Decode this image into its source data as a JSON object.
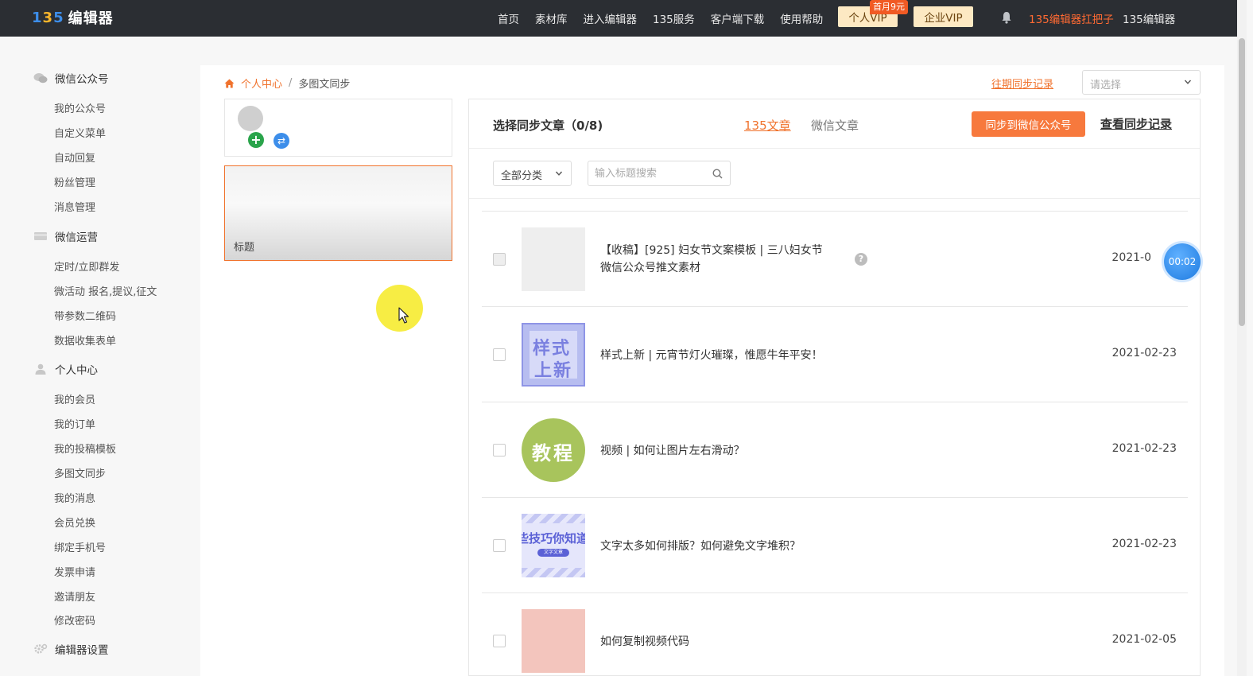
{
  "header": {
    "logo_mark": "135",
    "logo_text": "编辑器",
    "nav": [
      "首页",
      "素材库",
      "进入编辑器",
      "135服务",
      "客户端下载",
      "使用帮助"
    ],
    "vip_personal": "个人VIP",
    "vip_badge": "首月9元",
    "vip_enterprise": "企业VIP",
    "user_link": "135编辑器扛把子",
    "user_name": "135编辑器"
  },
  "sidebar": {
    "groups": [
      {
        "label": "微信公众号",
        "icon": "wechat-icon",
        "items": [
          "我的公众号",
          "自定义菜单",
          "自动回复",
          "粉丝管理",
          "消息管理"
        ]
      },
      {
        "label": "微信运营",
        "icon": "card-icon",
        "items": [
          "定时/立即群发",
          "微活动 报名,提议,征文",
          "带参数二维码",
          "数据收集表单"
        ]
      },
      {
        "label": "个人中心",
        "icon": "user-icon",
        "items": [
          "我的会员",
          "我的订单",
          "我的投稿模板",
          "多图文同步",
          "我的消息",
          "会员兑换",
          "绑定手机号",
          "发票申请",
          "邀请朋友",
          "修改密码"
        ]
      },
      {
        "label": "编辑器设置",
        "icon": "gear-icon",
        "items": []
      }
    ]
  },
  "breadcrumb": {
    "parent": "个人中心",
    "separator": "/",
    "current": "多图文同步"
  },
  "history_link": "往期同步记录",
  "account_select": {
    "placeholder": "请选择"
  },
  "cover": {
    "title": "标题"
  },
  "panel": {
    "title": "选择同步文章（0/8)",
    "tab_135": "135文章",
    "tab_wechat": "微信文章",
    "sync_button": "同步到微信公众号",
    "view_record": "查看同步记录",
    "category": "全部分类",
    "search_placeholder": "输入标题搜索"
  },
  "timer": "00:02",
  "articles": [
    {
      "title_line1": "【收稿】[925] 妇女节文案模板 | 三八妇女节",
      "title_line2": "微信公众号推文素材",
      "date": "2021-0",
      "thumb": "blank"
    },
    {
      "title_line1": "样式上新 | 元宵节灯火璀璨，惟愿牛年平安！",
      "date": "2021-02-23",
      "thumb": "style",
      "thumb_text_1": "样式",
      "thumb_text_2": "上新"
    },
    {
      "title_line1": "视频 | 如何让图片左右滑动？",
      "date": "2021-02-23",
      "thumb": "tutorial",
      "thumb_text": "教程"
    },
    {
      "title_line1": "文字太多如何排版？如何避免文字堆积？",
      "date": "2021-02-23",
      "thumb": "tips",
      "thumb_text": "些技巧你知道",
      "thumb_sub": "文字文章"
    },
    {
      "title_line1": "如何复制视频代码",
      "date": "2021-02-05",
      "thumb": "pink"
    }
  ]
}
